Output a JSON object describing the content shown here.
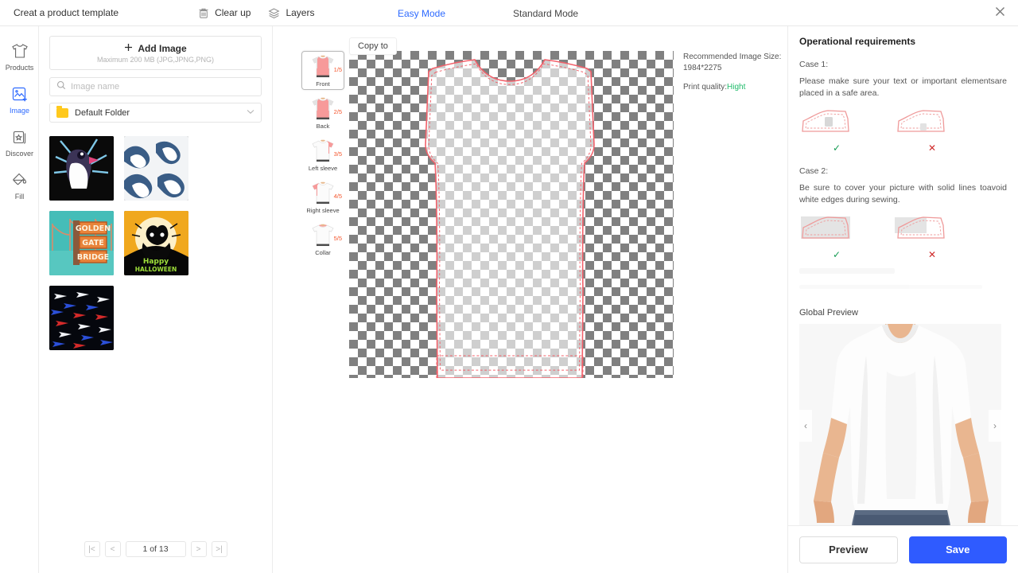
{
  "topbar": {
    "title": "Creat a product template",
    "tools": [
      {
        "label": "Clear up",
        "icon": "trash-icon"
      },
      {
        "label": "Layers",
        "icon": "layers-icon"
      }
    ],
    "modes": [
      {
        "label": "Easy Mode",
        "active": true
      },
      {
        "label": "Standard Mode",
        "active": false
      }
    ],
    "close_icon": "close-icon"
  },
  "rail": {
    "items": [
      {
        "label": "Products",
        "icon": "tshirt-icon",
        "active": false
      },
      {
        "label": "Image",
        "icon": "image-plus-icon",
        "active": true
      },
      {
        "label": "Discover",
        "icon": "star-card-icon",
        "active": false
      },
      {
        "label": "Fill",
        "icon": "paint-bucket-icon",
        "active": false
      }
    ]
  },
  "image_panel": {
    "add_image_label": "Add Image",
    "add_image_hint": "Maximum 200 MB (JPG,JPNG,PNG)",
    "search_placeholder": "Image name",
    "search_value": "",
    "folder_label": "Default Folder",
    "thumbnails": [
      {
        "name": "penguin-artwork"
      },
      {
        "name": "wave-pattern"
      },
      {
        "name": "golden-gate-bridge-sign"
      },
      {
        "name": "happy-halloween-cat"
      },
      {
        "name": "shark-pattern"
      }
    ],
    "pagination": {
      "first": "|<",
      "prev": "<",
      "page_text": "1 of 13",
      "next": ">",
      "last": ">|"
    }
  },
  "editor": {
    "copy_to_label": "Copy to",
    "views": [
      {
        "name": "Front",
        "count": "1/5",
        "active": true
      },
      {
        "name": "Back",
        "count": "2/5",
        "active": false
      },
      {
        "name": "Left sleeve",
        "count": "3/5",
        "active": false
      },
      {
        "name": "Right sleeve",
        "count": "4/5",
        "active": false
      },
      {
        "name": "Collar",
        "count": "5/5",
        "active": false
      }
    ],
    "recommended_size_label": "Recommended Image Size:",
    "recommended_size_value": "1984*2275",
    "print_quality_label": "Print quality:",
    "print_quality_value": "Hight",
    "print_quality_color": "#1fbb6a"
  },
  "right_panel": {
    "title": "Operational requirements",
    "case1_label": "Case 1:",
    "case1_text": "Please make sure your text or important elementsare placed in a safe area.",
    "case1_ok_mark": "✓",
    "case1_no_mark": "✕",
    "case2_label": "Case 2:",
    "case2_text": "Be sure to cover your picture with solid lines toavoid white edges during sewing.",
    "case2_ok_mark": "✓",
    "case2_no_mark": "✕",
    "global_preview_label": "Global Preview",
    "carousel_prev": "‹",
    "carousel_next": "›",
    "swatches": [
      {
        "name": "white",
        "color": "#ffffff"
      },
      {
        "name": "dark-gray",
        "color": "#3d3d3d"
      }
    ],
    "preview_button": "Preview",
    "save_button": "Save",
    "save_color": "#2f5bff"
  }
}
